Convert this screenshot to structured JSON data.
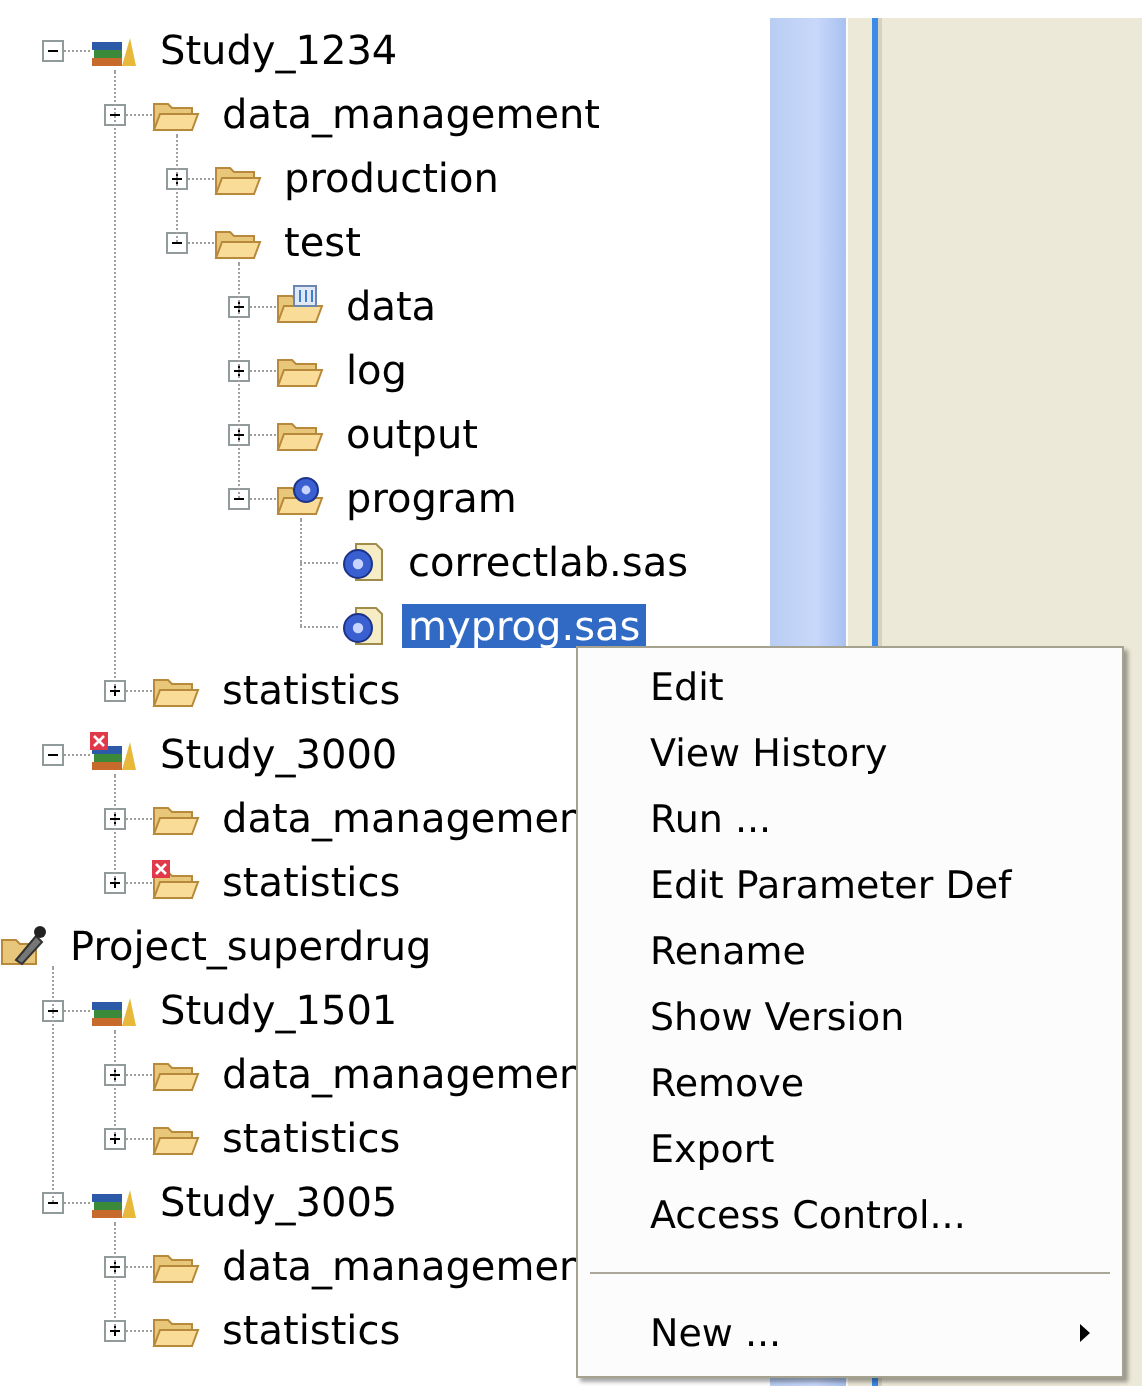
{
  "tree": {
    "continued": [
      {
        "label": "Study_1234",
        "kind": "study",
        "error": false,
        "expanded": true,
        "selected": false,
        "children": [
          {
            "label": "data_management",
            "kind": "folder",
            "error": false,
            "expanded": true,
            "selected": false,
            "children": [
              {
                "label": "production",
                "kind": "folder",
                "error": false,
                "expanded": false,
                "selected": false
              },
              {
                "label": "test",
                "kind": "folder",
                "error": false,
                "expanded": true,
                "selected": false,
                "children": [
                  {
                    "label": "data",
                    "kind": "data-folder",
                    "error": false,
                    "expanded": false,
                    "selected": false
                  },
                  {
                    "label": "log",
                    "kind": "folder",
                    "error": false,
                    "expanded": false,
                    "selected": false
                  },
                  {
                    "label": "output",
                    "kind": "folder",
                    "error": false,
                    "expanded": false,
                    "selected": false
                  },
                  {
                    "label": "program",
                    "kind": "program-folder",
                    "error": false,
                    "expanded": true,
                    "selected": false,
                    "children": [
                      {
                        "label": "correctlab.sas",
                        "kind": "program-file",
                        "error": false,
                        "selected": false
                      },
                      {
                        "label": "myprog.sas",
                        "kind": "program-file",
                        "error": false,
                        "selected": true
                      }
                    ]
                  }
                ]
              }
            ]
          },
          {
            "label": "statistics",
            "kind": "folder",
            "error": false,
            "expanded": false,
            "selected": false
          }
        ]
      },
      {
        "label": "Study_3000",
        "kind": "study",
        "error": true,
        "expanded": true,
        "selected": false,
        "children": [
          {
            "label": "data_managemen",
            "kind": "folder",
            "error": false,
            "expanded": false,
            "selected": false
          },
          {
            "label": "statistics",
            "kind": "folder",
            "error": true,
            "expanded": false,
            "selected": false
          }
        ]
      }
    ],
    "items": [
      {
        "label": "Project_superdrug",
        "kind": "project",
        "error": false,
        "selected": false,
        "children": [
          {
            "label": "Study_1501",
            "kind": "study",
            "error": false,
            "expanded": true,
            "selected": false,
            "children": [
              {
                "label": "data_managemen",
                "kind": "folder",
                "error": false,
                "expanded": false,
                "selected": false
              },
              {
                "label": "statistics",
                "kind": "folder",
                "error": false,
                "expanded": false,
                "selected": false
              }
            ]
          },
          {
            "label": "Study_3005",
            "kind": "study",
            "error": false,
            "expanded": true,
            "selected": false,
            "children": [
              {
                "label": "data_managemen",
                "kind": "folder",
                "error": false,
                "expanded": false,
                "selected": false
              },
              {
                "label": "statistics",
                "kind": "folder",
                "error": false,
                "expanded": false,
                "selected": false
              }
            ]
          }
        ]
      }
    ]
  },
  "context_menu": [
    {
      "kind": "item",
      "label": "Edit"
    },
    {
      "kind": "item",
      "label": "View History"
    },
    {
      "kind": "item",
      "label": "Run ..."
    },
    {
      "kind": "item",
      "label": "Edit Parameter Def"
    },
    {
      "kind": "item",
      "label": "Rename"
    },
    {
      "kind": "item",
      "label": "Show Version"
    },
    {
      "kind": "item",
      "label": "Remove"
    },
    {
      "kind": "item",
      "label": "Export"
    },
    {
      "kind": "item",
      "label": "Access Control..."
    },
    {
      "kind": "separator"
    },
    {
      "kind": "submenu",
      "label": "New ..."
    }
  ]
}
